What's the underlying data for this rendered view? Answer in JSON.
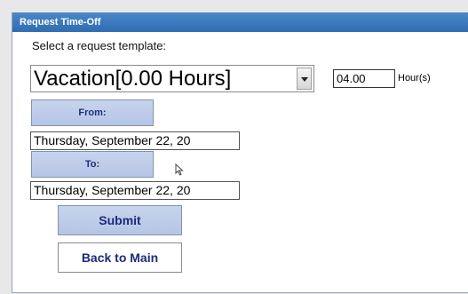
{
  "window": {
    "title": "Request Time-Off"
  },
  "template": {
    "label": "Select a request template:",
    "selected": "Vacation[0.00 Hours]"
  },
  "hours": {
    "value": "04.00",
    "unit": "Hour(s)"
  },
  "from": {
    "label": "From:",
    "date": "Thursday, September 22, 20"
  },
  "to": {
    "label": "To:",
    "date": "Thursday, September 22, 20"
  },
  "actions": {
    "submit": "Submit",
    "back": "Back to Main"
  },
  "colors": {
    "title_bar": "#2f6cb0",
    "button_face": "#b5c5e6",
    "button_text": "#1e2f80"
  }
}
